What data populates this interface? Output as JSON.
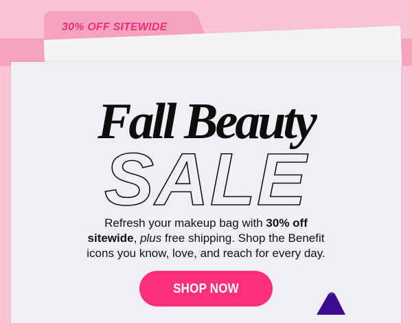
{
  "colors": {
    "page_pink": "#f9c5d6",
    "tab_pink": "#f7a3bf",
    "tab_text": "#ee2f78",
    "sheet": "#f0eff3",
    "cta_bg": "#ff2f7b",
    "cta_text": "#ffffff",
    "product_purple": "#3d0c8e"
  },
  "tab": {
    "label": "30% OFF SITEWIDE"
  },
  "hero": {
    "headline": "Fall Beauty",
    "sale_word": "SALE"
  },
  "body": {
    "line1_pre": "Refresh your makeup bag with ",
    "line1_bold": "30% off",
    "line2_bold": "sitewide",
    "line2_sep": ", ",
    "line2_italic": "plus",
    "line2_post": " free shipping. Shop the Benefit",
    "line3": "icons you know, love, and reach for every day."
  },
  "cta": {
    "label": "SHOP NOW"
  },
  "product": {
    "icon": "product-cap-icon"
  }
}
